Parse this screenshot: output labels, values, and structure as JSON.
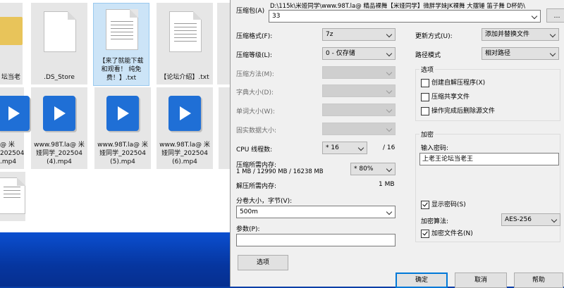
{
  "explorer": {
    "tiles": [
      {
        "label": "坛当老",
        "kind": "folder"
      },
      {
        "label": ".DS_Store",
        "kind": "file"
      },
      {
        "label": "【来了就能下载\n和观看！ 纯免\n费！】.txt",
        "kind": "text"
      },
      {
        "label": "【论坛介绍】.txt",
        "kind": "text"
      },
      {
        "label": "@ 米\n202504\n.mp4",
        "kind": "video"
      },
      {
        "label": "www.98T.la@ 米\n娅同学_202504\n(4).mp4",
        "kind": "video"
      },
      {
        "label": "www.98T.la@ 米\n娅同学_202504\n(5).mp4",
        "kind": "video"
      },
      {
        "label": "www.98T.la@ 米\n娅同学_202504\n(6).mp4",
        "kind": "video"
      }
    ]
  },
  "dialog": {
    "archive_label": "压缩包(A)",
    "archive_path": "D:\\115k\\米娅同学\\www.98T.la@ 精品裸舞【米娅同学】微胖学妹JK裸舞 大摆锤 笛子舞 D杯奶\\",
    "archive_name": "33",
    "format_label": "压缩格式(F):",
    "format_value": "7z",
    "level_label": "压缩等级(L):",
    "level_value": "0 - 仅存储",
    "method_label": "压缩方法(M):",
    "dict_label": "字典大小(D):",
    "word_label": "单词大小(W):",
    "solid_label": "固实数据大小:",
    "threads_label": "CPU 线程数:",
    "threads_value": "* 16",
    "threads_max": "/ 16",
    "mem_comp_label": "压缩所需内存:",
    "mem_comp_value": "1 MB / 12990 MB / 16238 MB",
    "mem_percent": "* 80%",
    "mem_decomp_label": "解压所需内存:",
    "mem_decomp_value": "1 MB",
    "split_label": "分卷大小，字节(V):",
    "split_value": "500m",
    "params_label": "参数(P):",
    "params_value": "",
    "update_label": "更新方式(U):",
    "update_value": "添加并替换文件",
    "path_label": "路径模式",
    "path_value": "相对路径",
    "options_group": "选项",
    "opt_sfx": "创建自解压程序(X)",
    "opt_shared": "压缩共享文件",
    "opt_delete": "操作完成后删除源文件",
    "encrypt_group": "加密",
    "password_label": "输入密码:",
    "password_value": "上老王论坛当老王",
    "show_password": "显示密码(S)",
    "enc_method_label": "加密算法:",
    "enc_method_value": "AES-256",
    "enc_names": "加密文件名(N)",
    "options_button": "选项",
    "ok_button": "确定",
    "cancel_button": "取消",
    "help_button": "帮助"
  }
}
